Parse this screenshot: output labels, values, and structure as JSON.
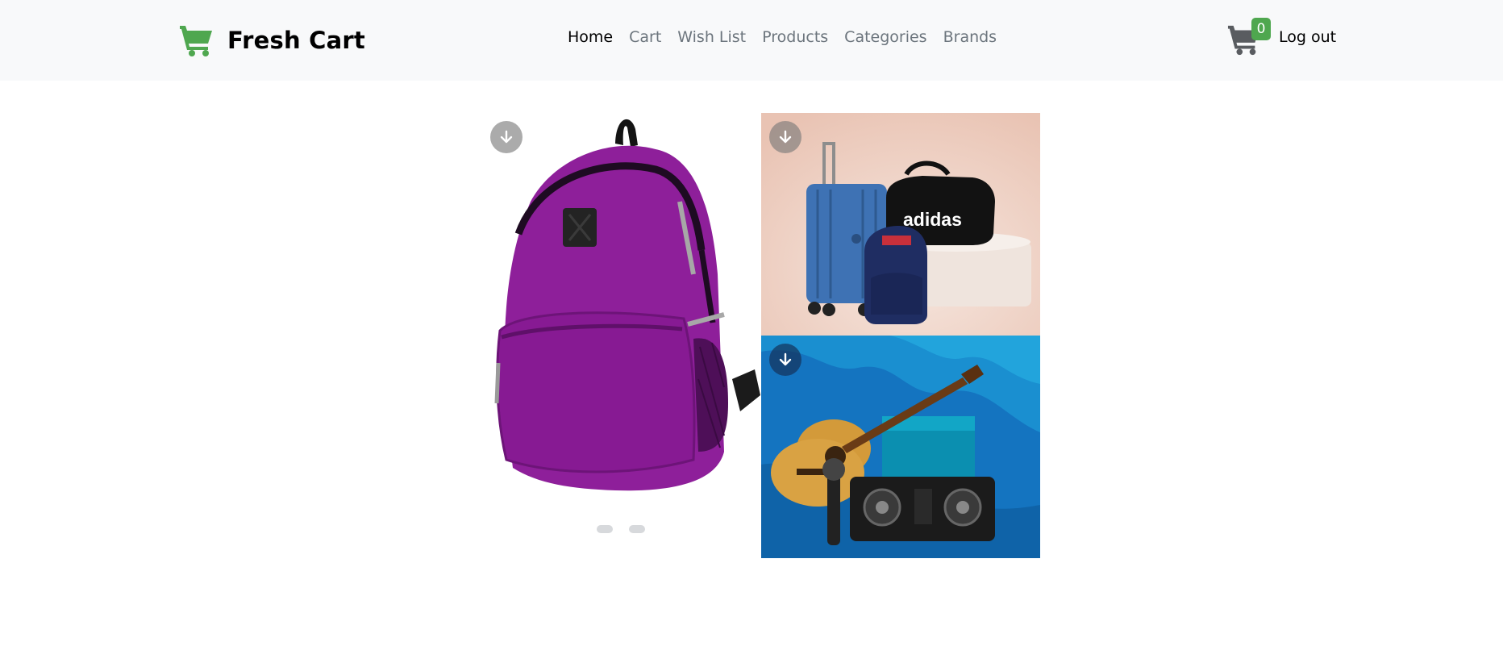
{
  "navbar": {
    "brand": "Fresh Cart",
    "links": [
      {
        "label": "Home",
        "active": true
      },
      {
        "label": "Cart",
        "active": false
      },
      {
        "label": "Wish List",
        "active": false
      },
      {
        "label": "Products",
        "active": false
      },
      {
        "label": "Categories",
        "active": false
      },
      {
        "label": "Brands",
        "active": false
      }
    ],
    "cart_count": "0",
    "logout_label": "Log out"
  },
  "banner_texts": {
    "adidas": "adidas"
  },
  "colors": {
    "brand_green": "#4fa74f",
    "navbar_bg": "#f8f9fa",
    "backpack_purple": "#8e1f9a",
    "music_blue": "#1474c0"
  },
  "icons": {
    "brand": "cart-shopping-icon",
    "cart": "cart-shopping-icon",
    "download": "arrow-down-circle-icon"
  }
}
